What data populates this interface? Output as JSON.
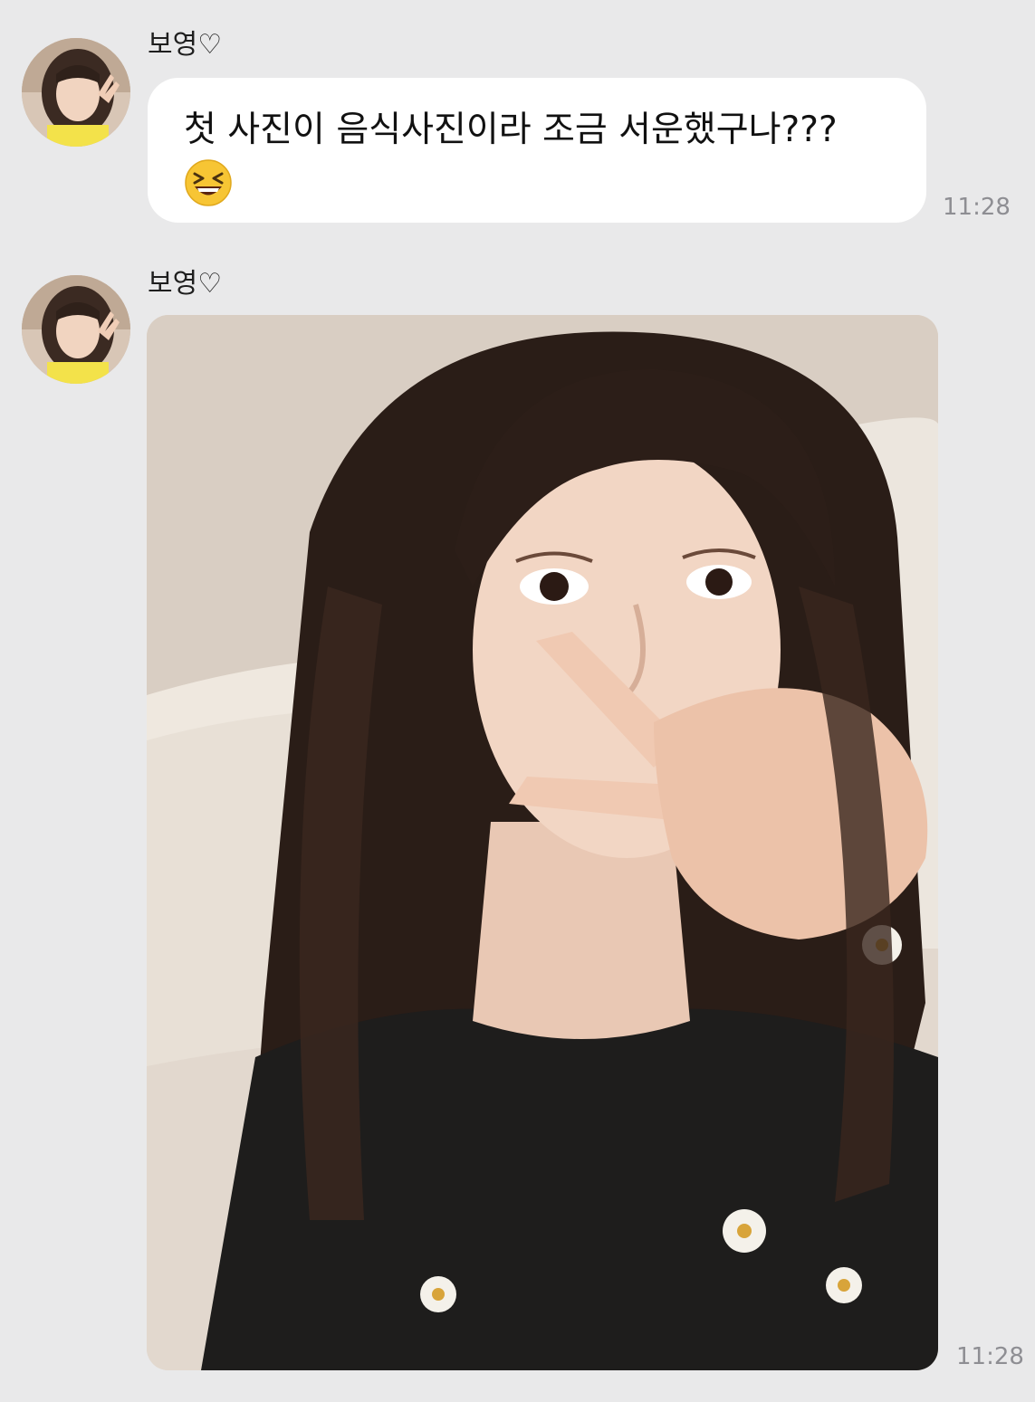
{
  "messages": [
    {
      "sender": "보영♡",
      "text": "첫 사진이 음식사진이라 조금 서운했구나???",
      "emoji": "laughing-squint-emoji",
      "time": "11:28"
    },
    {
      "sender": "보영♡",
      "attachment": "selfie-photo",
      "time": "11:28"
    }
  ],
  "colors": {
    "background": "#e9e9ea",
    "bubble": "#ffffff",
    "text": "#111111",
    "timestamp": "#8e8e93"
  }
}
